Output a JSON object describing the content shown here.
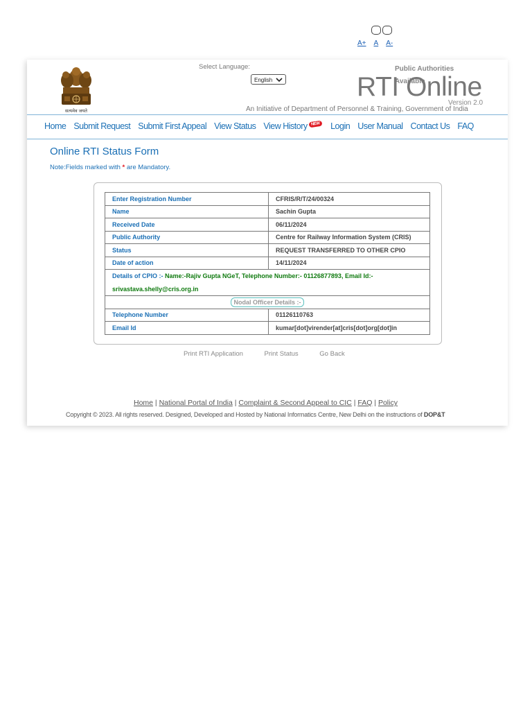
{
  "accessibility": {
    "increase": "A+",
    "normal": "A",
    "decrease": "A-"
  },
  "header": {
    "emblem_motto": "सत्यमेव जयते",
    "select_language_label": "Select Language:",
    "language_selected": "English",
    "public_authorities_line1": "Public Authorities",
    "public_authorities_line2": "Available",
    "site_title": "RTI Online",
    "version": "Version 2.0",
    "initiative": "An Initiative of Department of Personnel & Training, Government of India"
  },
  "nav": {
    "home": "Home",
    "submit_request": "Submit Request",
    "submit_first_appeal": "Submit First Appeal",
    "view_status": "View Status",
    "view_history": "View History",
    "new_badge": "NEW",
    "login": "Login",
    "user_manual": "User Manual",
    "contact_us": "Contact Us",
    "faq": "FAQ"
  },
  "form": {
    "title": "Online RTI Status Form",
    "note_prefix": "Note:Fields marked with ",
    "note_star": "*",
    "note_suffix": " are Mandatory."
  },
  "status": {
    "registration_label": "Enter Registration Number",
    "registration_value": "CFRIS/R/T/24/00324",
    "name_label": "Name",
    "name_value": "Sachin Gupta",
    "received_label": "Received Date",
    "received_value": "06/11/2024",
    "authority_label": "Public Authority",
    "authority_value": "Centre for Railway Information System (CRIS)",
    "status_label": "Status",
    "status_value": "REQUEST TRANSFERRED TO OTHER CPIO",
    "action_label": "Date of action",
    "action_value": "14/11/2024",
    "cpio_label": "Details of CPIO :- ",
    "cpio_line1": "Name:-Rajiv Gupta NGeT, Telephone Number:- 01126877893, Email Id:-",
    "cpio_line2": "srivastava.shelly@cris.org.in",
    "nodal_header": "Nodal Officer Details :-",
    "telephone_label": "Telephone Number",
    "telephone_value": "01126110763",
    "email_label": "Email Id",
    "email_value": "kumar[dot]virender[at]cris[dot]org[dot]in"
  },
  "actions": {
    "print_application": "Print RTI Application",
    "print_status": "Print Status",
    "go_back": "Go Back"
  },
  "footer": {
    "home": "Home",
    "national_portal": "National Portal of India",
    "complaint": "Complaint & Second Appeal to CIC",
    "faq": "FAQ",
    "policy": "Policy",
    "separator": " | ",
    "copyright": "Copyright © 2023. All rights reserved. Designed, Developed and Hosted by National Informatics Centre, New Delhi on the instructions of ",
    "dopt": "DOP&T"
  },
  "colors": {
    "accent_blue": "#1a6fb5",
    "cpio_green": "#0f7a0f",
    "mandatory_red": "#e01b24"
  }
}
